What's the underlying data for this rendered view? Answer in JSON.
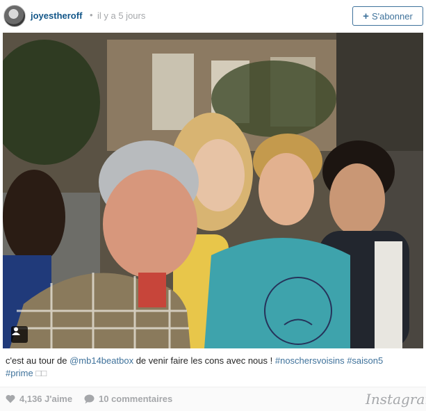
{
  "header": {
    "username": "joyestheroff",
    "separator": "•",
    "time_ago": "il y a 5 jours",
    "follow_label": "S'abonner",
    "follow_icon": "plus-icon"
  },
  "photo": {
    "description_icon": "user-tag-icon",
    "colors": {
      "shirt_teal": "#3ea3ac",
      "shirt_yellow": "#e8c64a",
      "plaid": "#8a7a5c"
    }
  },
  "caption": {
    "text_before": "c'est au tour de ",
    "mention": "@mb14beatbox",
    "text_middle": " de venir faire les cons avec nous ! ",
    "hashtag1": "#noschersvoisins",
    "hashtag2": "#saison5",
    "hashtag3": "#prime",
    "emoji": "□□"
  },
  "footer": {
    "likes": "4,136 J'aime",
    "comments": "10 commentaires",
    "brand": "Instagram",
    "like_icon": "heart-icon",
    "comment_icon": "speech-bubble-icon"
  },
  "colors": {
    "link": "#3f729b",
    "username": "#125688",
    "muted": "#a5a7aa"
  }
}
